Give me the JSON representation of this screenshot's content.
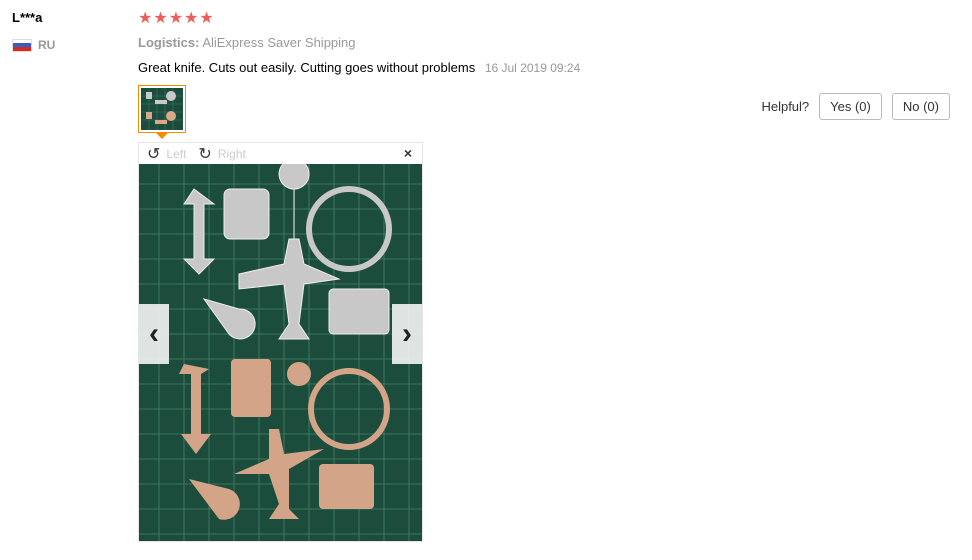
{
  "reviewer": {
    "name": "L***a",
    "country": "RU"
  },
  "rating": {
    "stars": 5,
    "color": "#ee5f5b"
  },
  "logistics": {
    "label": "Logistics:",
    "value": "AliExpress Saver Shipping"
  },
  "review": {
    "text": "Great knife. Cuts out easily. Cutting goes without problems",
    "date": "16 Jul 2019 09:24"
  },
  "helpful": {
    "label": "Helpful?",
    "yes": "Yes (0)",
    "no": "No (0)"
  },
  "viewer": {
    "rotate_left": "Left",
    "rotate_right": "Right",
    "close": "×",
    "prev": "‹",
    "next": "›"
  },
  "colors": {
    "accent": "#f18d00",
    "mat": "#1c4d3c"
  }
}
